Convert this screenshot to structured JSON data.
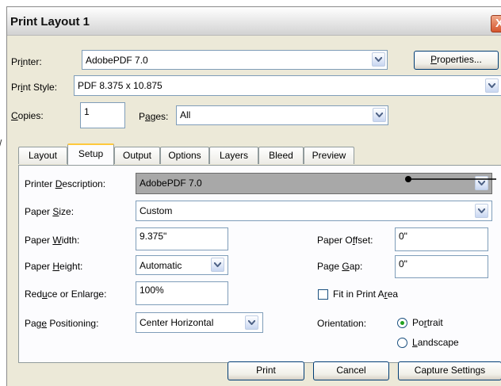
{
  "window": {
    "title": "Print Layout 1",
    "close_glyph": "X"
  },
  "top": {
    "printer_label": "Printer:",
    "printer_value": "AdobePDF 7.0",
    "properties_label": "Properties...",
    "print_style_label": "Print Style:",
    "print_style_value": "PDF 8.375 x 10.875",
    "copies_label": "Copies:",
    "copies_value": "1",
    "pages_label": "Pages:",
    "pages_value": "All"
  },
  "tabs": [
    "Layout",
    "Setup",
    "Output",
    "Options",
    "Layers",
    "Bleed",
    "Preview"
  ],
  "active_tab": "Setup",
  "setup": {
    "printer_description_label": "Printer Description:",
    "printer_description_value": "AdobePDF 7.0",
    "paper_size_label": "Paper Size:",
    "paper_size_value": "Custom",
    "paper_width_label": "Paper Width:",
    "paper_width_value": "9.375\"",
    "paper_height_label": "Paper Height:",
    "paper_height_value": "Automatic",
    "reduce_label": "Reduce or Enlarge:",
    "reduce_value": "100%",
    "page_positioning_label": "Page Positioning:",
    "page_positioning_value": "Center Horizontal",
    "paper_offset_label": "Paper Offset:",
    "paper_offset_value": "0\"",
    "page_gap_label": "Page Gap:",
    "page_gap_value": "0\"",
    "fit_label": "Fit in Print Area",
    "fit_checked": false,
    "orientation_label": "Orientation:",
    "portrait_label": "Portrait",
    "landscape_label": "Landscape",
    "orientation_selected": "Portrait"
  },
  "footer": {
    "print_label": "Print",
    "cancel_label": "Cancel",
    "capture_label": "Capture Settings"
  },
  "colors": {
    "dialog_bg": "#ece9d8",
    "field_border": "#7f9db9",
    "tab_highlight": "#ffc83c",
    "close_red": "#d5552d",
    "selected_row": "#a8a8a8"
  }
}
